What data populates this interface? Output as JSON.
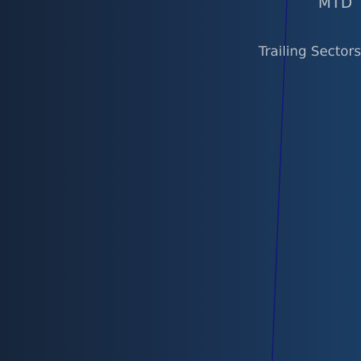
{
  "labels": {
    "period": "MTD",
    "section": "Trailing Sectors"
  },
  "colors": {
    "background_left": "#16253a",
    "background_right": "#1b3d63",
    "divider": "#15157a",
    "label_text": "#b9c0c8"
  }
}
